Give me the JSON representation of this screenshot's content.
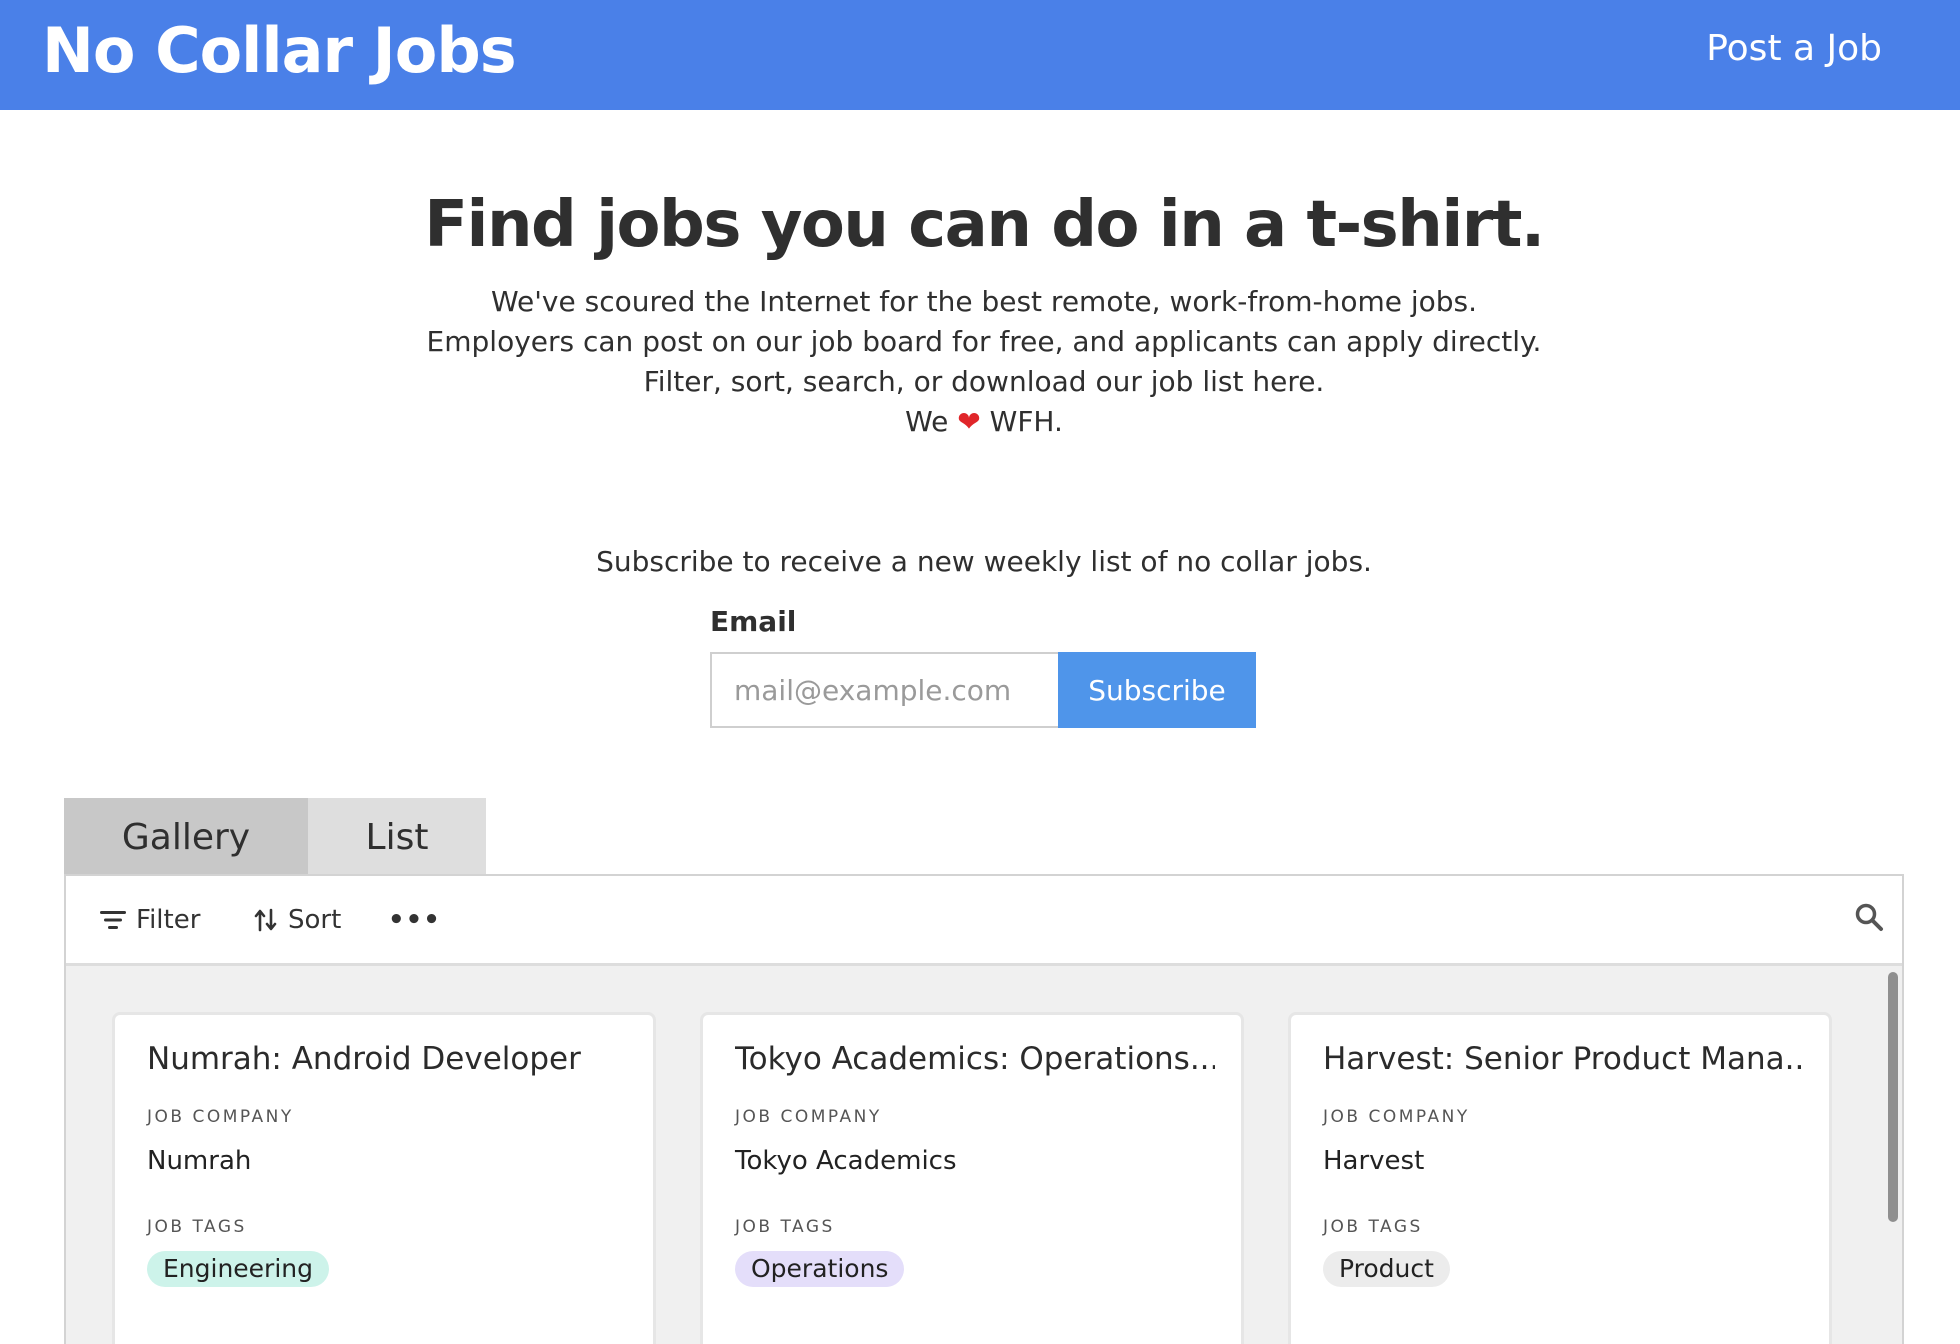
{
  "header": {
    "brand": "No Collar Jobs",
    "post_link": "Post a Job",
    "background_color": "#4a80e8"
  },
  "hero": {
    "title": "Find jobs you can do in a t-shirt.",
    "line1": "We've scoured the Internet for the best remote, work-from-home jobs.",
    "line2": "Employers can post on our job board for free, and applicants can apply directly.",
    "line3": "Filter, sort, search, or download our job list here.",
    "line4_prefix": "We",
    "line4_heart": "❤",
    "line4_suffix": "WFH."
  },
  "subscribe": {
    "text": "Subscribe to receive a new weekly list of no collar jobs.",
    "email_label": "Email",
    "email_placeholder": "mail@example.com",
    "email_value": "",
    "button_label": "Subscribe",
    "button_color": "#4f95ea"
  },
  "tabs": [
    {
      "label": "Gallery",
      "active": true
    },
    {
      "label": "List",
      "active": false
    }
  ],
  "toolbar": {
    "filter_label": "Filter",
    "sort_label": "Sort",
    "more_label": "•••",
    "filter_icon": "filter-icon",
    "sort_icon": "sort-icon",
    "search_icon": "search-icon"
  },
  "cards": [
    {
      "title": "Numrah: Android Developer",
      "company_label": "JOB COMPANY",
      "company": "Numrah",
      "tags_label": "JOB TAGS",
      "tag": "Engineering",
      "tag_color": "#cdf3ea"
    },
    {
      "title": "Tokyo Academics: Operations...",
      "company_label": "JOB COMPANY",
      "company": "Tokyo Academics",
      "tags_label": "JOB TAGS",
      "tag": "Operations",
      "tag_color": "#e4defa"
    },
    {
      "title": "Harvest: Senior Product Mana...",
      "company_label": "JOB COMPANY",
      "company": "Harvest",
      "tags_label": "JOB TAGS",
      "tag": "Product",
      "tag_color": "#ececec"
    }
  ]
}
